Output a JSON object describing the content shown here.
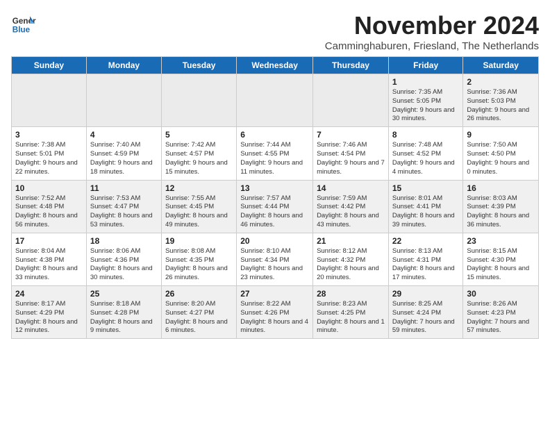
{
  "logo": {
    "line1": "General",
    "line2": "Blue"
  },
  "title": "November 2024",
  "location": "Camminghaburen, Friesland, The Netherlands",
  "weekdays": [
    "Sunday",
    "Monday",
    "Tuesday",
    "Wednesday",
    "Thursday",
    "Friday",
    "Saturday"
  ],
  "weeks": [
    [
      {
        "day": "",
        "info": ""
      },
      {
        "day": "",
        "info": ""
      },
      {
        "day": "",
        "info": ""
      },
      {
        "day": "",
        "info": ""
      },
      {
        "day": "",
        "info": ""
      },
      {
        "day": "1",
        "info": "Sunrise: 7:35 AM\nSunset: 5:05 PM\nDaylight: 9 hours and 30 minutes."
      },
      {
        "day": "2",
        "info": "Sunrise: 7:36 AM\nSunset: 5:03 PM\nDaylight: 9 hours and 26 minutes."
      }
    ],
    [
      {
        "day": "3",
        "info": "Sunrise: 7:38 AM\nSunset: 5:01 PM\nDaylight: 9 hours and 22 minutes."
      },
      {
        "day": "4",
        "info": "Sunrise: 7:40 AM\nSunset: 4:59 PM\nDaylight: 9 hours and 18 minutes."
      },
      {
        "day": "5",
        "info": "Sunrise: 7:42 AM\nSunset: 4:57 PM\nDaylight: 9 hours and 15 minutes."
      },
      {
        "day": "6",
        "info": "Sunrise: 7:44 AM\nSunset: 4:55 PM\nDaylight: 9 hours and 11 minutes."
      },
      {
        "day": "7",
        "info": "Sunrise: 7:46 AM\nSunset: 4:54 PM\nDaylight: 9 hours and 7 minutes."
      },
      {
        "day": "8",
        "info": "Sunrise: 7:48 AM\nSunset: 4:52 PM\nDaylight: 9 hours and 4 minutes."
      },
      {
        "day": "9",
        "info": "Sunrise: 7:50 AM\nSunset: 4:50 PM\nDaylight: 9 hours and 0 minutes."
      }
    ],
    [
      {
        "day": "10",
        "info": "Sunrise: 7:52 AM\nSunset: 4:48 PM\nDaylight: 8 hours and 56 minutes."
      },
      {
        "day": "11",
        "info": "Sunrise: 7:53 AM\nSunset: 4:47 PM\nDaylight: 8 hours and 53 minutes."
      },
      {
        "day": "12",
        "info": "Sunrise: 7:55 AM\nSunset: 4:45 PM\nDaylight: 8 hours and 49 minutes."
      },
      {
        "day": "13",
        "info": "Sunrise: 7:57 AM\nSunset: 4:44 PM\nDaylight: 8 hours and 46 minutes."
      },
      {
        "day": "14",
        "info": "Sunrise: 7:59 AM\nSunset: 4:42 PM\nDaylight: 8 hours and 43 minutes."
      },
      {
        "day": "15",
        "info": "Sunrise: 8:01 AM\nSunset: 4:41 PM\nDaylight: 8 hours and 39 minutes."
      },
      {
        "day": "16",
        "info": "Sunrise: 8:03 AM\nSunset: 4:39 PM\nDaylight: 8 hours and 36 minutes."
      }
    ],
    [
      {
        "day": "17",
        "info": "Sunrise: 8:04 AM\nSunset: 4:38 PM\nDaylight: 8 hours and 33 minutes."
      },
      {
        "day": "18",
        "info": "Sunrise: 8:06 AM\nSunset: 4:36 PM\nDaylight: 8 hours and 30 minutes."
      },
      {
        "day": "19",
        "info": "Sunrise: 8:08 AM\nSunset: 4:35 PM\nDaylight: 8 hours and 26 minutes."
      },
      {
        "day": "20",
        "info": "Sunrise: 8:10 AM\nSunset: 4:34 PM\nDaylight: 8 hours and 23 minutes."
      },
      {
        "day": "21",
        "info": "Sunrise: 8:12 AM\nSunset: 4:32 PM\nDaylight: 8 hours and 20 minutes."
      },
      {
        "day": "22",
        "info": "Sunrise: 8:13 AM\nSunset: 4:31 PM\nDaylight: 8 hours and 17 minutes."
      },
      {
        "day": "23",
        "info": "Sunrise: 8:15 AM\nSunset: 4:30 PM\nDaylight: 8 hours and 15 minutes."
      }
    ],
    [
      {
        "day": "24",
        "info": "Sunrise: 8:17 AM\nSunset: 4:29 PM\nDaylight: 8 hours and 12 minutes."
      },
      {
        "day": "25",
        "info": "Sunrise: 8:18 AM\nSunset: 4:28 PM\nDaylight: 8 hours and 9 minutes."
      },
      {
        "day": "26",
        "info": "Sunrise: 8:20 AM\nSunset: 4:27 PM\nDaylight: 8 hours and 6 minutes."
      },
      {
        "day": "27",
        "info": "Sunrise: 8:22 AM\nSunset: 4:26 PM\nDaylight: 8 hours and 4 minutes."
      },
      {
        "day": "28",
        "info": "Sunrise: 8:23 AM\nSunset: 4:25 PM\nDaylight: 8 hours and 1 minute."
      },
      {
        "day": "29",
        "info": "Sunrise: 8:25 AM\nSunset: 4:24 PM\nDaylight: 7 hours and 59 minutes."
      },
      {
        "day": "30",
        "info": "Sunrise: 8:26 AM\nSunset: 4:23 PM\nDaylight: 7 hours and 57 minutes."
      }
    ]
  ]
}
